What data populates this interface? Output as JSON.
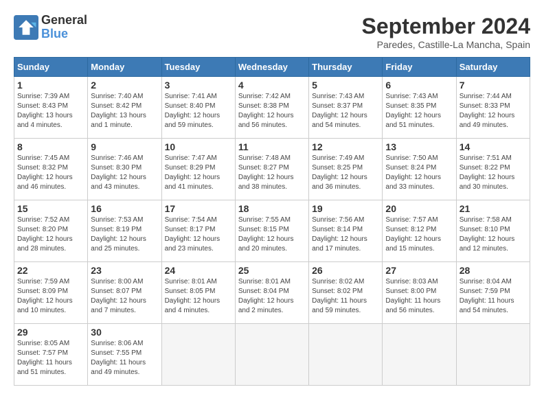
{
  "header": {
    "logo_line1": "General",
    "logo_line2": "Blue",
    "month_title": "September 2024",
    "location": "Paredes, Castille-La Mancha, Spain"
  },
  "weekdays": [
    "Sunday",
    "Monday",
    "Tuesday",
    "Wednesday",
    "Thursday",
    "Friday",
    "Saturday"
  ],
  "weeks": [
    [
      {
        "day": "1",
        "sunrise": "7:39 AM",
        "sunset": "8:43 PM",
        "daylight": "13 hours and 4 minutes."
      },
      {
        "day": "2",
        "sunrise": "7:40 AM",
        "sunset": "8:42 PM",
        "daylight": "13 hours and 1 minute."
      },
      {
        "day": "3",
        "sunrise": "7:41 AM",
        "sunset": "8:40 PM",
        "daylight": "12 hours and 59 minutes."
      },
      {
        "day": "4",
        "sunrise": "7:42 AM",
        "sunset": "8:38 PM",
        "daylight": "12 hours and 56 minutes."
      },
      {
        "day": "5",
        "sunrise": "7:43 AM",
        "sunset": "8:37 PM",
        "daylight": "12 hours and 54 minutes."
      },
      {
        "day": "6",
        "sunrise": "7:43 AM",
        "sunset": "8:35 PM",
        "daylight": "12 hours and 51 minutes."
      },
      {
        "day": "7",
        "sunrise": "7:44 AM",
        "sunset": "8:33 PM",
        "daylight": "12 hours and 49 minutes."
      }
    ],
    [
      {
        "day": "8",
        "sunrise": "7:45 AM",
        "sunset": "8:32 PM",
        "daylight": "12 hours and 46 minutes."
      },
      {
        "day": "9",
        "sunrise": "7:46 AM",
        "sunset": "8:30 PM",
        "daylight": "12 hours and 43 minutes."
      },
      {
        "day": "10",
        "sunrise": "7:47 AM",
        "sunset": "8:29 PM",
        "daylight": "12 hours and 41 minutes."
      },
      {
        "day": "11",
        "sunrise": "7:48 AM",
        "sunset": "8:27 PM",
        "daylight": "12 hours and 38 minutes."
      },
      {
        "day": "12",
        "sunrise": "7:49 AM",
        "sunset": "8:25 PM",
        "daylight": "12 hours and 36 minutes."
      },
      {
        "day": "13",
        "sunrise": "7:50 AM",
        "sunset": "8:24 PM",
        "daylight": "12 hours and 33 minutes."
      },
      {
        "day": "14",
        "sunrise": "7:51 AM",
        "sunset": "8:22 PM",
        "daylight": "12 hours and 30 minutes."
      }
    ],
    [
      {
        "day": "15",
        "sunrise": "7:52 AM",
        "sunset": "8:20 PM",
        "daylight": "12 hours and 28 minutes."
      },
      {
        "day": "16",
        "sunrise": "7:53 AM",
        "sunset": "8:19 PM",
        "daylight": "12 hours and 25 minutes."
      },
      {
        "day": "17",
        "sunrise": "7:54 AM",
        "sunset": "8:17 PM",
        "daylight": "12 hours and 23 minutes."
      },
      {
        "day": "18",
        "sunrise": "7:55 AM",
        "sunset": "8:15 PM",
        "daylight": "12 hours and 20 minutes."
      },
      {
        "day": "19",
        "sunrise": "7:56 AM",
        "sunset": "8:14 PM",
        "daylight": "12 hours and 17 minutes."
      },
      {
        "day": "20",
        "sunrise": "7:57 AM",
        "sunset": "8:12 PM",
        "daylight": "12 hours and 15 minutes."
      },
      {
        "day": "21",
        "sunrise": "7:58 AM",
        "sunset": "8:10 PM",
        "daylight": "12 hours and 12 minutes."
      }
    ],
    [
      {
        "day": "22",
        "sunrise": "7:59 AM",
        "sunset": "8:09 PM",
        "daylight": "12 hours and 10 minutes."
      },
      {
        "day": "23",
        "sunrise": "8:00 AM",
        "sunset": "8:07 PM",
        "daylight": "12 hours and 7 minutes."
      },
      {
        "day": "24",
        "sunrise": "8:01 AM",
        "sunset": "8:05 PM",
        "daylight": "12 hours and 4 minutes."
      },
      {
        "day": "25",
        "sunrise": "8:01 AM",
        "sunset": "8:04 PM",
        "daylight": "12 hours and 2 minutes."
      },
      {
        "day": "26",
        "sunrise": "8:02 AM",
        "sunset": "8:02 PM",
        "daylight": "11 hours and 59 minutes."
      },
      {
        "day": "27",
        "sunrise": "8:03 AM",
        "sunset": "8:00 PM",
        "daylight": "11 hours and 56 minutes."
      },
      {
        "day": "28",
        "sunrise": "8:04 AM",
        "sunset": "7:59 PM",
        "daylight": "11 hours and 54 minutes."
      }
    ],
    [
      {
        "day": "29",
        "sunrise": "8:05 AM",
        "sunset": "7:57 PM",
        "daylight": "11 hours and 51 minutes."
      },
      {
        "day": "30",
        "sunrise": "8:06 AM",
        "sunset": "7:55 PM",
        "daylight": "11 hours and 49 minutes."
      },
      null,
      null,
      null,
      null,
      null
    ]
  ]
}
